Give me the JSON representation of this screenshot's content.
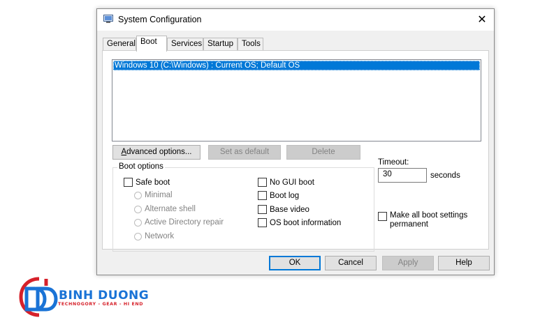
{
  "window": {
    "title": "System Configuration",
    "close_glyph": "✕"
  },
  "tabs": [
    {
      "label": "General"
    },
    {
      "label": "Boot"
    },
    {
      "label": "Services"
    },
    {
      "label": "Startup"
    },
    {
      "label": "Tools"
    }
  ],
  "boot_list": {
    "items": [
      "Windows 10 (C:\\Windows) : Current OS; Default OS"
    ]
  },
  "boot_buttons": {
    "advanced": "Advanced options...",
    "set_default": "Set as default",
    "delete": "Delete"
  },
  "boot_options": {
    "legend": "Boot options",
    "safe_boot": "Safe boot",
    "radios": [
      "Minimal",
      "Alternate shell",
      "Active Directory repair",
      "Network"
    ],
    "no_gui": "No GUI boot",
    "boot_log": "Boot log",
    "base_video": "Base video",
    "os_boot_info": "OS boot information"
  },
  "timeout": {
    "label": "Timeout:",
    "value": "30",
    "unit": "seconds"
  },
  "permanent": {
    "line1": "Make all boot settings",
    "line2": "permanent"
  },
  "footer": {
    "ok": "OK",
    "cancel": "Cancel",
    "apply": "Apply",
    "help": "Help"
  },
  "watermark": {
    "title": "BINH DUONG",
    "subtitle": "TECHNOGORY - GEAR - HI END"
  },
  "colors": {
    "selection": "#0078d7",
    "logo_blue": "#1a73d6",
    "logo_red": "#d6212a"
  }
}
